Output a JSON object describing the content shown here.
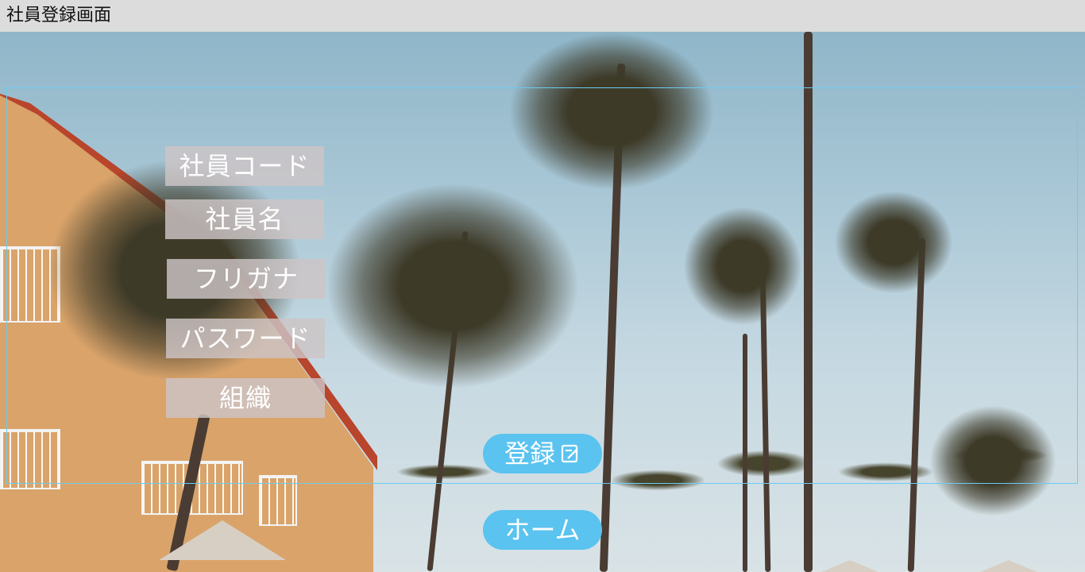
{
  "window": {
    "title": "社員登録画面"
  },
  "form": {
    "labels": [
      "社員コード",
      "社員名",
      "フリガナ",
      "パスワード",
      "組織"
    ]
  },
  "buttons": {
    "register": {
      "label": "登録",
      "icon": "edit-icon"
    },
    "home": {
      "label": "ホーム"
    }
  },
  "colors": {
    "accent": "#5bc3ef",
    "frame": "#6ccbef",
    "title_bar": "#dcdcdc"
  }
}
